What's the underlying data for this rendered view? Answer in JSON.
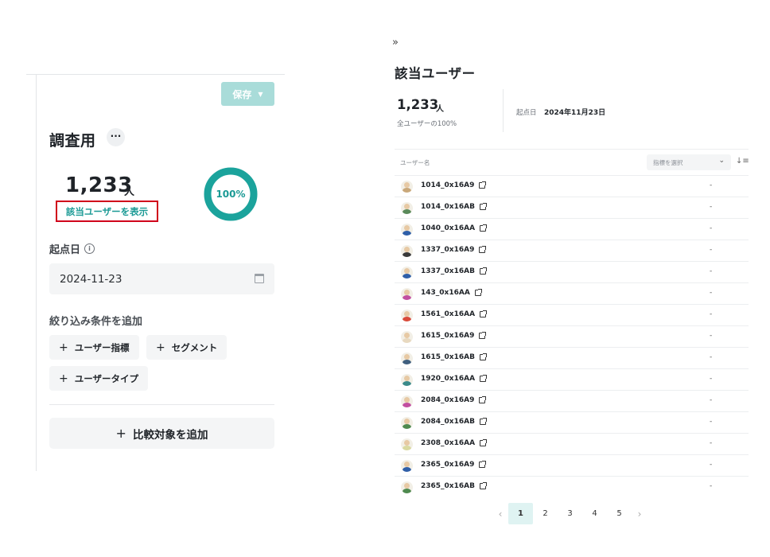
{
  "left_panel": {
    "save_label": "保存",
    "title": "調査用",
    "more_label": "···",
    "user_count": "1,233",
    "user_unit": "人",
    "show_users_label": "該当ユーザーを表示",
    "progress_percent": 100,
    "progress_label": "100%",
    "start_date_label": "起点日",
    "start_date_value": "2024-11-23",
    "filter_label": "絞り込み条件を追加",
    "filter_chips": {
      "user_metric": "ユーザー指標",
      "segment": "セグメント",
      "user_type": "ユーザータイプ"
    },
    "compare_label": "比較対象を追加",
    "accent_color": "#1ba39c"
  },
  "right_panel": {
    "expand_icon": "»",
    "title": "該当ユーザー",
    "user_count": "1,233",
    "user_unit": "人",
    "share_label": "全ユーザーの100%",
    "start_date_label": "起点日",
    "start_date_value": "2024年11月23日",
    "column_header": "ユーザー名",
    "metric_select_placeholder": "指標を選択",
    "users": [
      {
        "name": "1014_0x16A9",
        "value": "-",
        "body_color": "#c9a87a"
      },
      {
        "name": "1014_0x16AB",
        "value": "-",
        "body_color": "#5a8a5a"
      },
      {
        "name": "1040_0x16AA",
        "value": "-",
        "body_color": "#2f5fa8"
      },
      {
        "name": "1337_0x16A9",
        "value": "-",
        "body_color": "#3a3a3a"
      },
      {
        "name": "1337_0x16AB",
        "value": "-",
        "body_color": "#2f5fa8"
      },
      {
        "name": "143_0x16AA",
        "value": "-",
        "body_color": "#c24fa0"
      },
      {
        "name": "1561_0x16AA",
        "value": "-",
        "body_color": "#d94a3a"
      },
      {
        "name": "1615_0x16A9",
        "value": "-",
        "body_color": "#e8d9c0"
      },
      {
        "name": "1615_0x16AB",
        "value": "-",
        "body_color": "#3f5f7f"
      },
      {
        "name": "1920_0x16AA",
        "value": "-",
        "body_color": "#3a8a8a"
      },
      {
        "name": "2084_0x16A9",
        "value": "-",
        "body_color": "#c24fa0"
      },
      {
        "name": "2084_0x16AB",
        "value": "-",
        "body_color": "#4f8a4f"
      },
      {
        "name": "2308_0x16AA",
        "value": "-",
        "body_color": "#d9d9a0"
      },
      {
        "name": "2365_0x16A9",
        "value": "-",
        "body_color": "#2f5fa8"
      },
      {
        "name": "2365_0x16AB",
        "value": "-",
        "body_color": "#4f8a4f"
      }
    ],
    "pagination": {
      "prev": "‹",
      "next": "›",
      "pages": [
        "1",
        "2",
        "3",
        "4",
        "5"
      ],
      "current": "1"
    }
  }
}
